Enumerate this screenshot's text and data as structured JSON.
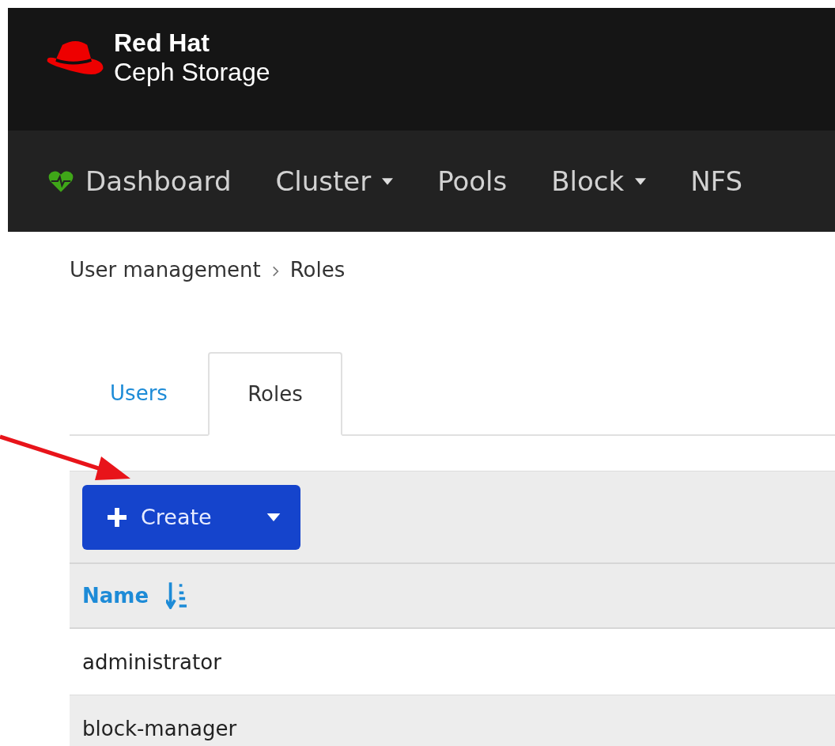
{
  "brand": {
    "line_1": "Red Hat",
    "line_2": "Ceph Storage"
  },
  "nav": [
    {
      "label": "Dashboard",
      "kind": "home"
    },
    {
      "label": "Cluster",
      "kind": "dropdown"
    },
    {
      "label": "Pools",
      "kind": "link"
    },
    {
      "label": "Block",
      "kind": "dropdown"
    },
    {
      "label": "NFS",
      "kind": "link"
    }
  ],
  "breadcrumb": [
    "User management",
    "Roles"
  ],
  "tabs": [
    {
      "label": "Users",
      "selected": false
    },
    {
      "label": "Roles",
      "selected": true
    }
  ],
  "toolbar": {
    "create_button": "Create"
  },
  "table": {
    "columns": [
      {
        "label": "Name",
        "sorted": true
      }
    ],
    "rows": [
      [
        "administrator"
      ],
      [
        "block-manager"
      ]
    ]
  }
}
